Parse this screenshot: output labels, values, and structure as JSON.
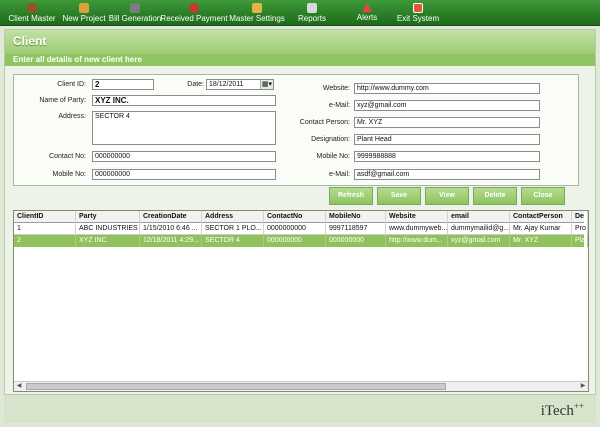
{
  "toolbar": {
    "items": [
      {
        "label": "Client Master",
        "icon": "user-icon",
        "color": "#8a5a2b"
      },
      {
        "label": "New Project",
        "icon": "home-icon",
        "color": "#d9a33a"
      },
      {
        "label": "Bill Generation",
        "icon": "calculator-icon",
        "color": "#7c7c7c"
      },
      {
        "label": "Received Payment",
        "icon": "payment-icon",
        "color": "#c43a2f"
      },
      {
        "label": "Master Settings",
        "icon": "settings-icon",
        "color": "#e6b34a"
      },
      {
        "label": "Reports",
        "icon": "reports-icon",
        "color": "#d9d9d9"
      },
      {
        "label": "Alerts",
        "icon": "alert-icon",
        "color": "#e04b3a"
      },
      {
        "label": "Exit System",
        "icon": "exit-icon",
        "color": "#e0583a"
      }
    ]
  },
  "window": {
    "title": "Client",
    "subtitle": "Enter all details of new client here"
  },
  "form": {
    "client_id": {
      "label": "Client ID:",
      "value": "2"
    },
    "date": {
      "label": "Date:",
      "value": "18/12/2011"
    },
    "name_of_party": {
      "label": "Name of Party:",
      "value": "XYZ INC."
    },
    "address": {
      "label": "Address:",
      "value": "SECTOR 4"
    },
    "contact_no": {
      "label": "Contact No:",
      "value": "000000000"
    },
    "mobile_no_left": {
      "label": "Mobile No:",
      "value": "000000000"
    },
    "website": {
      "label": "Website:",
      "value": "http://www.dummy.com"
    },
    "email_1": {
      "label": "e-Mail:",
      "value": "xyz@gmail.com"
    },
    "contact_person": {
      "label": "Contact Person:",
      "value": "Mr. XYZ"
    },
    "designation": {
      "label": "Designation:",
      "value": "Plant Head"
    },
    "mobile_no_right": {
      "label": "Mobile No:",
      "value": "9999988888"
    },
    "email_2": {
      "label": "e-Mail:",
      "value": "asdf@gmail.com"
    }
  },
  "buttons": {
    "refresh": "Refresh",
    "save": "Save",
    "view": "View",
    "delete": "Delete",
    "close": "Close"
  },
  "grid": {
    "columns": [
      "ClientID",
      "Party",
      "CreationDate",
      "Address",
      "ContactNo",
      "MobileNo",
      "Website",
      "email",
      "ContactPerson",
      "De"
    ],
    "rows": [
      [
        "1",
        "ABC INDUSTRIES",
        "1/15/2010 6:46 ...",
        "SECTOR 1 PLO...",
        "0000000000",
        "9997118597",
        "www.dummyweb...",
        "dummymailid@g...",
        "Mr. Ajay Kumar",
        "Pro"
      ],
      [
        "2",
        "XYZ INC.",
        "12/18/2011 4:29...",
        "SECTOR 4",
        "000000000",
        "000000000",
        "http://www.dum...",
        "xyz@gmail.com",
        "Mr. XYZ",
        "Pla"
      ]
    ]
  },
  "footer": {
    "brand": "iTech",
    "brand_sup": "++"
  },
  "colors": {
    "toolbar": "#2b7f27",
    "accent": "#8fc15c",
    "selected_row": "#8fc15c"
  }
}
